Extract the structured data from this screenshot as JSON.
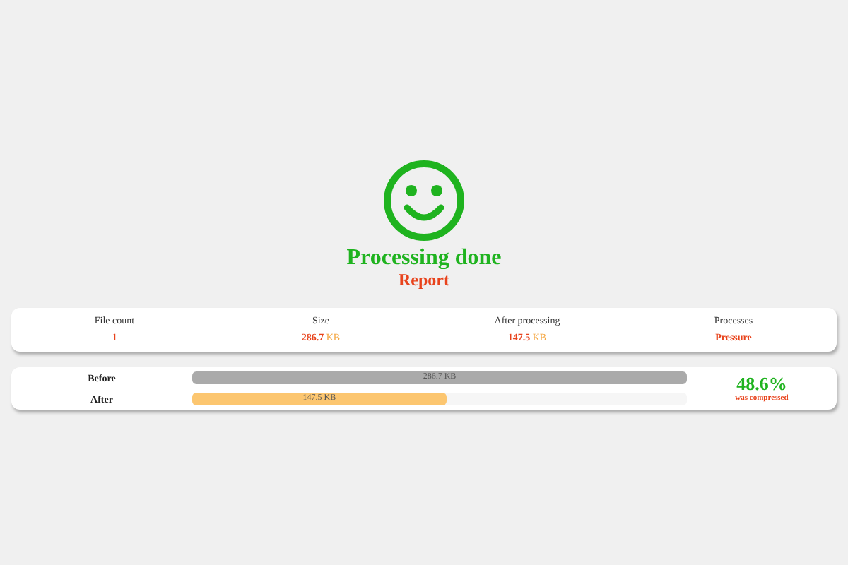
{
  "status": {
    "title": "Processing done",
    "subtitle": "Report"
  },
  "stats": [
    {
      "label": "File count",
      "value": "1"
    },
    {
      "label": "Size",
      "value": "286.7",
      "unit": "KB"
    },
    {
      "label": "After processing",
      "value": "147.5",
      "unit": "KB"
    },
    {
      "label": "Processes",
      "value": "Pressure"
    }
  ],
  "bars": [
    {
      "label": "Before",
      "reading": "286.7 KB",
      "level": 1,
      "color": "#aaaaaa"
    },
    {
      "label": "After",
      "reading": "147.5 KB",
      "level": 0.514,
      "color": "#fcc670"
    }
  ],
  "result": {
    "percent": "48.6%",
    "caption": "was compressed"
  }
}
